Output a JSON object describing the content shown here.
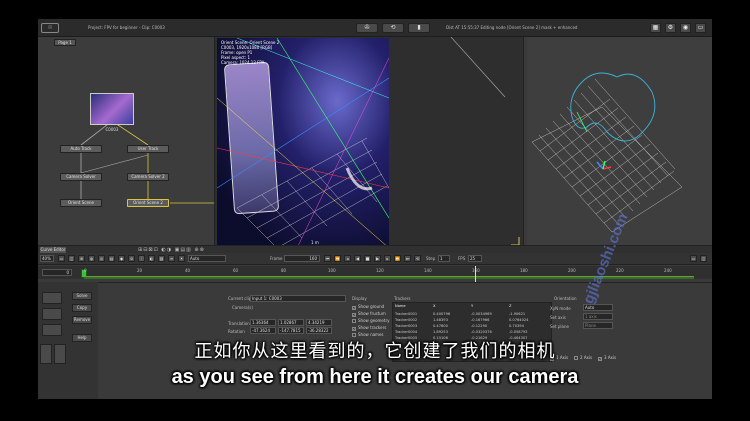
{
  "topbar": {
    "logo": "☉",
    "project": "Project: FPV for beginner - Clip: C0003",
    "status": "Dist AT 15:55:37 Editing node [Orient Scene 2] mask + enhanced",
    "btn1": "✇",
    "btn2": "⟲",
    "btn3": "▮"
  },
  "node_editor": {
    "tab": "Page 1",
    "clip_label": "C0003",
    "nodes": {
      "auto_track": "Auto Track",
      "user_track": "User Track",
      "camera_solver": "Camera Solver",
      "camera_solver_2": "Camera Solver 2",
      "orient_scene": "Orient Scene",
      "orient_scene_2": "Orient Scene 2"
    }
  },
  "viewer": {
    "overlay": [
      "Orient Scene: Orient Scene 2",
      "C0003, 1920x1080 [RGB]",
      "Frame: open P1",
      "Pixel aspect: 1",
      "Camera: 1024.12 FPA"
    ],
    "scale_label": "1 m"
  },
  "timeline": {
    "curve_tab": "Curve Editor",
    "zoom": "40%",
    "mode": "Auto",
    "frame_label": "Frame",
    "frame_value": "160",
    "step_label": "Step",
    "step_value": "1",
    "fps_label": "FPS",
    "fps_value": "25",
    "start_frame": "0",
    "ticks": [
      "0",
      "20",
      "40",
      "60",
      "80",
      "100",
      "120",
      "140",
      "160",
      "180",
      "200",
      "220",
      "240"
    ]
  },
  "inspector": {
    "buttons": {
      "solve": "Solve",
      "copy": "Copy",
      "remove": "Remove",
      "help": "Help"
    },
    "current_clip_label": "Current clip",
    "current_clip_value": "Input 1: C0003",
    "camera_label": "Camera(s)",
    "translation_label": "Translation",
    "translation": [
      "1.36364",
      "1.02867",
      "4.34219"
    ],
    "rotation_label": "Rotation",
    "rotation": [
      "-47.3624",
      "-147.7815",
      "-36.28322"
    ],
    "display_label": "Display",
    "display_options": [
      "Show ground",
      "Show frustum",
      "Show geometry",
      "Show trackers",
      "Show names"
    ],
    "trackers_label": "Trackers",
    "tracker_header": [
      "Name",
      "X",
      "Y",
      "Z"
    ],
    "trackers": [
      [
        "Tracker0001",
        "0.400796",
        "-0.0034969",
        "-1.90621"
      ],
      [
        "Tracker0002",
        "1.48393",
        "-0.167966",
        "0.0764024"
      ],
      [
        "Tracker0003",
        "0.47600",
        "-0.12290",
        "0.70394"
      ],
      [
        "Tracker0004",
        "1.89253",
        "-0.0320376",
        "-0.058793"
      ],
      [
        "Tracker0005",
        "0.15106",
        "-0.21629",
        "-0.404307"
      ]
    ],
    "orientation_label": "Orientation",
    "xyz_mode_label": "XyN mode",
    "xyz_mode_value": "Auto",
    "set_axis_label": "Set axis",
    "set_axis_value": "1 axis",
    "set_plane_label": "Set plane",
    "set_plane_value": "Plane",
    "axes": [
      "1 Axis",
      "2 Axis",
      "3 Axis"
    ]
  },
  "subtitle": {
    "chinese": "正如你从这里看到的，它创建了我们的相机",
    "english": "as you see from here it creates our camera"
  },
  "watermark": "gjliaoshi.com",
  "colors": {
    "accent_green": "#3ec23a",
    "selected_node": "#d8c640",
    "track_line": "#39b5d8",
    "subtitle": "#ffffff"
  }
}
